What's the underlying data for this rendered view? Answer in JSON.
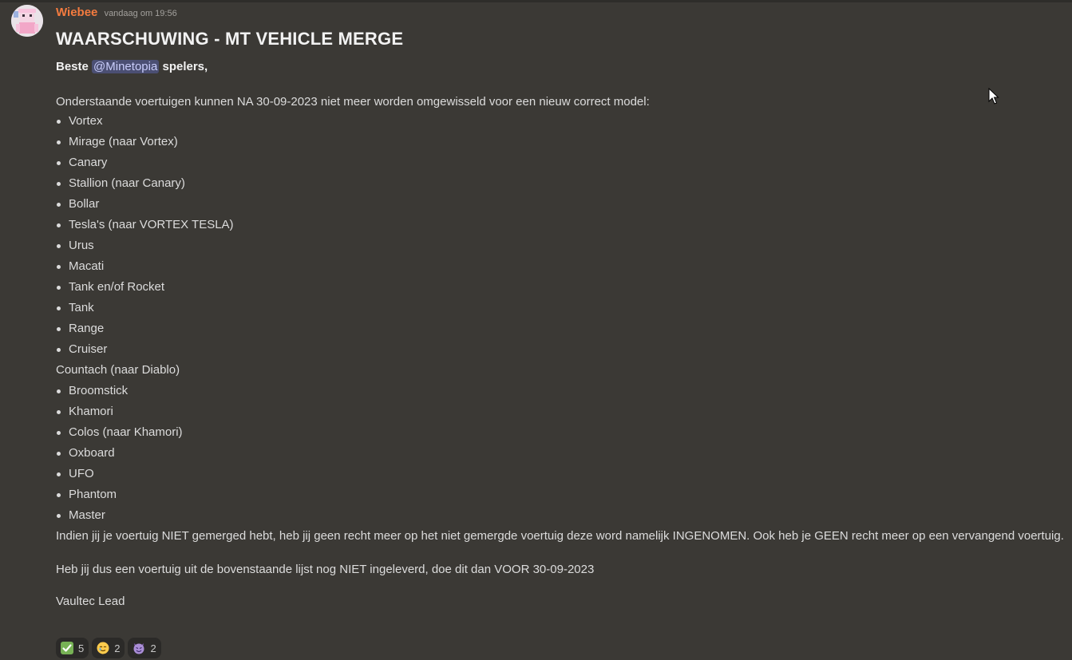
{
  "message": {
    "author": "Wiebee",
    "timestamp": "vandaag om 19:56",
    "title": "WAARSCHUWING - MT VEHICLE MERGE",
    "greeting_prefix": "Beste ",
    "mention": "@Minetopia",
    "greeting_suffix": " spelers,",
    "intro": "Onderstaande voertuigen kunnen NA 30-09-2023 niet meer worden omgewisseld voor een nieuw correct model:",
    "list_a": [
      "Vortex",
      "Mirage (naar Vortex)",
      "Canary",
      "Stallion (naar Canary)",
      "Bollar",
      "Tesla's (naar VORTEX TESLA)",
      "Urus",
      "Macati",
      "Tank en/of Rocket",
      "Tank",
      "Range",
      "Cruiser"
    ],
    "plain_item": "Countach (naar Diablo)",
    "list_b": [
      "Broomstick",
      "Khamori",
      "Colos (naar Khamori)",
      "Oxboard",
      "UFO",
      "Phantom",
      "Master"
    ],
    "warning": "Indien jij je voertuig NIET gemerged hebt, heb jij geen recht meer op het niet gemergde voertuig deze word namelijk INGENOMEN. Ook heb je GEEN recht meer op een vervangend voertuig.",
    "reminder": "Heb jij dus een voertuig uit de bovenstaande lijst nog NIET ingeleverd, doe dit dan VOOR 30-09-2023",
    "signature": "Vaultec Lead"
  },
  "reactions": [
    {
      "icon": "check-mark-emoji",
      "count": "5"
    },
    {
      "icon": "teary-smile-emoji",
      "count": "2"
    },
    {
      "icon": "smiling-devil-emoji",
      "count": "2"
    }
  ],
  "colors": {
    "background": "#3b3935",
    "author": "#f47b3f",
    "mention_bg": "#4b4f73",
    "text": "#dcdcdc"
  }
}
